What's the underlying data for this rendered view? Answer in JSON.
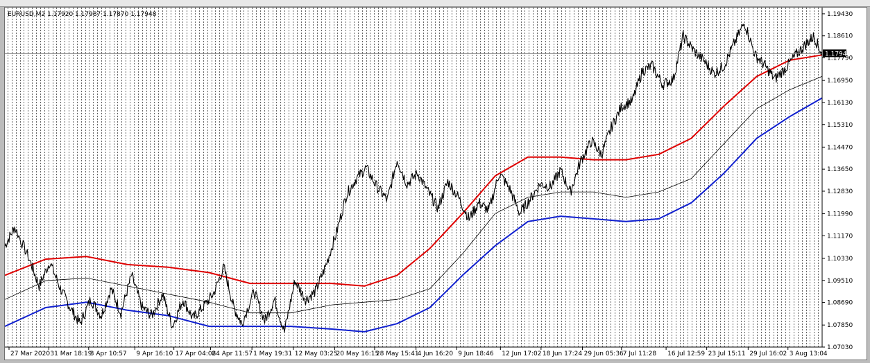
{
  "window": {
    "symbol_label": "EURUSD,M2  1.17920 1.17987 1.17870 1.17948"
  },
  "chart_data": {
    "type": "line",
    "title": "",
    "symbol": "EURUSD",
    "timeframe": "M2",
    "ohlc": {
      "open": 1.1792,
      "high": 1.17987,
      "low": 1.1787,
      "close": 1.17948
    },
    "current_price": 1.17948,
    "current_price_label": "1.17948",
    "ylim": [
      1.0703,
      1.1966
    ],
    "yticks": [
      "1.19430",
      "1.18610",
      "1.17790",
      "1.16950",
      "1.16130",
      "1.15310",
      "1.14470",
      "1.13650",
      "1.12830",
      "1.11990",
      "1.11170",
      "1.10330",
      "1.09510",
      "1.08690",
      "1.07850",
      "1.07030"
    ],
    "xticks": [
      "27 Mar 2020",
      "31 Mar 18:19",
      "3 Apr 10:57",
      "9 Apr 16:10",
      "17 Apr 04:08",
      "24 Apr 11:57",
      "1 May 19:31",
      "12 May 03:25",
      "20 May 16:15",
      "28 May 15:41",
      "4 Jun 16:20",
      "9 Jun 18:46",
      "12 Jun 17:02",
      "18 Jun 17:24",
      "29 Jun 05:36",
      "7 Jul 11:28",
      "16 Jul 12:59",
      "23 Jul 15:11",
      "29 Jul 16:02",
      "3 Aug 13:04"
    ],
    "grid": false,
    "period_separators": true,
    "series": [
      {
        "color": "#000000",
        "style": "price",
        "x": [
          0,
          0.012,
          0.03,
          0.042,
          0.055,
          0.068,
          0.08,
          0.092,
          0.105,
          0.118,
          0.13,
          0.142,
          0.155,
          0.168,
          0.18,
          0.193,
          0.205,
          0.218,
          0.23,
          0.242,
          0.255,
          0.268,
          0.28,
          0.29,
          0.305,
          0.318,
          0.33,
          0.342,
          0.355,
          0.368,
          0.38,
          0.392,
          0.405,
          0.418,
          0.43,
          0.442,
          0.455,
          0.468,
          0.48,
          0.492,
          0.505,
          0.518,
          0.53,
          0.542,
          0.555,
          0.568,
          0.58,
          0.592,
          0.605,
          0.618,
          0.63,
          0.642,
          0.655,
          0.668,
          0.68,
          0.692,
          0.705,
          0.718,
          0.73,
          0.742,
          0.755,
          0.768,
          0.78,
          0.792,
          0.805,
          0.818,
          0.83,
          0.842,
          0.855,
          0.868,
          0.88,
          0.892,
          0.905,
          0.918,
          0.93,
          0.942,
          0.955,
          0.968,
          0.98,
          0.99,
          1.0
        ],
        "values": [
          1.108,
          1.115,
          1.103,
          1.093,
          1.102,
          1.092,
          1.085,
          1.079,
          1.088,
          1.082,
          1.092,
          1.083,
          1.097,
          1.085,
          1.082,
          1.09,
          1.078,
          1.088,
          1.081,
          1.085,
          1.09,
          1.1,
          1.085,
          1.079,
          1.091,
          1.08,
          1.088,
          1.076,
          1.095,
          1.088,
          1.091,
          1.1,
          1.112,
          1.127,
          1.133,
          1.137,
          1.13,
          1.125,
          1.14,
          1.131,
          1.135,
          1.128,
          1.122,
          1.132,
          1.126,
          1.118,
          1.124,
          1.121,
          1.135,
          1.129,
          1.12,
          1.125,
          1.131,
          1.13,
          1.136,
          1.128,
          1.14,
          1.147,
          1.142,
          1.152,
          1.16,
          1.162,
          1.173,
          1.175,
          1.168,
          1.17,
          1.186,
          1.181,
          1.177,
          1.172,
          1.175,
          1.183,
          1.191,
          1.179,
          1.175,
          1.17,
          1.174,
          1.179,
          1.183,
          1.186,
          1.179
        ]
      },
      {
        "color": "#e00000",
        "style": "upper-band",
        "x": [
          0,
          0.05,
          0.1,
          0.15,
          0.2,
          0.25,
          0.3,
          0.35,
          0.4,
          0.44,
          0.48,
          0.52,
          0.56,
          0.6,
          0.64,
          0.68,
          0.72,
          0.76,
          0.8,
          0.84,
          0.88,
          0.92,
          0.96,
          1.0
        ],
        "values": [
          1.097,
          1.103,
          1.104,
          1.101,
          1.1,
          1.098,
          1.094,
          1.094,
          1.094,
          1.093,
          1.097,
          1.107,
          1.12,
          1.134,
          1.141,
          1.141,
          1.14,
          1.14,
          1.142,
          1.148,
          1.16,
          1.171,
          1.177,
          1.179
        ]
      },
      {
        "color": "#000000",
        "style": "middle-band",
        "x": [
          0,
          0.05,
          0.1,
          0.15,
          0.2,
          0.25,
          0.3,
          0.35,
          0.4,
          0.44,
          0.48,
          0.52,
          0.56,
          0.6,
          0.64,
          0.68,
          0.72,
          0.76,
          0.8,
          0.84,
          0.88,
          0.92,
          0.96,
          1.0
        ],
        "values": [
          1.088,
          1.095,
          1.096,
          1.093,
          1.09,
          1.087,
          1.083,
          1.083,
          1.086,
          1.087,
          1.088,
          1.092,
          1.105,
          1.12,
          1.126,
          1.128,
          1.128,
          1.126,
          1.128,
          1.133,
          1.146,
          1.159,
          1.166,
          1.171
        ]
      },
      {
        "color": "#1020d0",
        "style": "lower-band",
        "x": [
          0,
          0.05,
          0.1,
          0.15,
          0.2,
          0.25,
          0.3,
          0.35,
          0.4,
          0.44,
          0.48,
          0.52,
          0.56,
          0.6,
          0.64,
          0.68,
          0.72,
          0.76,
          0.8,
          0.84,
          0.88,
          0.92,
          0.96,
          1.0
        ],
        "values": [
          1.078,
          1.085,
          1.087,
          1.084,
          1.082,
          1.078,
          1.078,
          1.078,
          1.077,
          1.076,
          1.079,
          1.085,
          1.097,
          1.108,
          1.117,
          1.119,
          1.118,
          1.117,
          1.118,
          1.124,
          1.135,
          1.148,
          1.156,
          1.163
        ]
      }
    ]
  }
}
